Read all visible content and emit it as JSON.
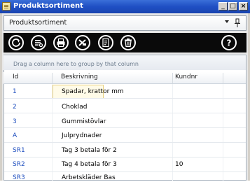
{
  "window": {
    "title": "Produktsortiment",
    "controls": [
      "_",
      "□",
      "×"
    ]
  },
  "panel": {
    "title": "Produktsortiment",
    "dropdown_icon": "chevron-down-icon",
    "pin_icon": "pin-icon"
  },
  "toolbar": {
    "buttons": [
      {
        "name": "refresh",
        "icon": "refresh-icon"
      },
      {
        "name": "filter-list",
        "icon": "filter-list-icon"
      },
      {
        "name": "print",
        "icon": "printer-icon"
      },
      {
        "name": "export-excel",
        "icon": "excel-icon"
      },
      {
        "name": "edit-document",
        "icon": "document-edit-icon"
      },
      {
        "name": "delete",
        "icon": "trash-icon"
      },
      {
        "name": "help",
        "icon": "help-icon"
      }
    ]
  },
  "grid": {
    "group_panel_text": "Drag a column here to group by that column",
    "columns": [
      "Id",
      "Beskrivning",
      "Kundnr"
    ],
    "rows": [
      {
        "id": "1",
        "beskrivning": "Spadar, krattor mm",
        "kundnr": ""
      },
      {
        "id": "2",
        "beskrivning": "Choklad",
        "kundnr": ""
      },
      {
        "id": "3",
        "beskrivning": "Gummistövlar",
        "kundnr": ""
      },
      {
        "id": "A",
        "beskrivning": "Julprydnader",
        "kundnr": ""
      },
      {
        "id": "SR1",
        "beskrivning": "Tag 3 betala för 2",
        "kundnr": ""
      },
      {
        "id": "SR2",
        "beskrivning": "Tag 4 betala för 3",
        "kundnr": "10"
      },
      {
        "id": "SR3",
        "beskrivning": "Arbetskläder Bas",
        "kundnr": ""
      }
    ]
  }
}
